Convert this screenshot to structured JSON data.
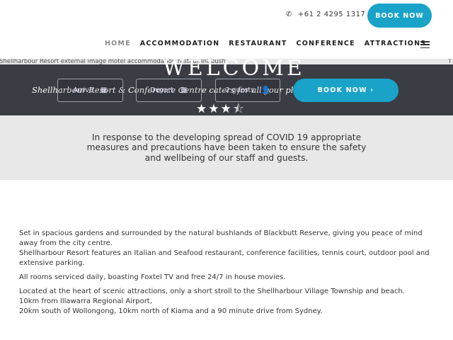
{
  "header": {
    "phone": "+61 2 4295 1317",
    "phone_icon": "phone-icon",
    "book_label": "BOOK NOW",
    "nav": [
      {
        "label": "HOME",
        "active": true
      },
      {
        "label": "ACCOMMODATION",
        "active": false
      },
      {
        "label": "RESTAURANT",
        "active": false
      },
      {
        "label": "CONFERENCE",
        "active": false
      },
      {
        "label": "ATTRACTIONS",
        "active": false
      }
    ],
    "menu_icon": "hamburger-icon"
  },
  "hero": {
    "broken_image_alt": "Shellharbour Resort external image motel accommodation restaurant bush",
    "right_mark": "T",
    "title": "WELCOME",
    "tagline": "Shellharbour Resort & Conference Centre caters for all your pleasure & business needs",
    "fields": [
      {
        "label": "Arrive",
        "icon": "calendar-icon",
        "glyph": "▦"
      },
      {
        "label": "Depart",
        "icon": "calendar-icon",
        "glyph": "▦"
      },
      {
        "label": "2 guests",
        "icon": "user-icon",
        "glyph": "👤"
      }
    ],
    "book_label": "BOOK NOW ›",
    "rating": 3.5
  },
  "notice": {
    "text": "In response to the developing spread of COVID 19 appropriate measures and precautions have been taken to ensure the safety and wellbeing of our staff and guests."
  },
  "content": {
    "p1": "Set in spacious gardens and surrounded by the natural bushlands of Blackbutt Reserve, giving you peace of mind away from the city centre.",
    "p2": "Shellharbour Resort features an Italian and Seafood restaurant, conference facilities, tennis court, outdoor pool and extensive parking.",
    "p3": "All rooms serviced daily, boasting Foxtel TV and free 24/7 in house movies.",
    "p4": "Located at the heart of scenic attractions, only a short stroll to the Shellharbour Village Township and beach.",
    "p5": "10km from Illawarra Regional Airport,",
    "p6": "20km south of Wollongong, 10km north of Kiama and a 90 minute drive from Sydney."
  }
}
